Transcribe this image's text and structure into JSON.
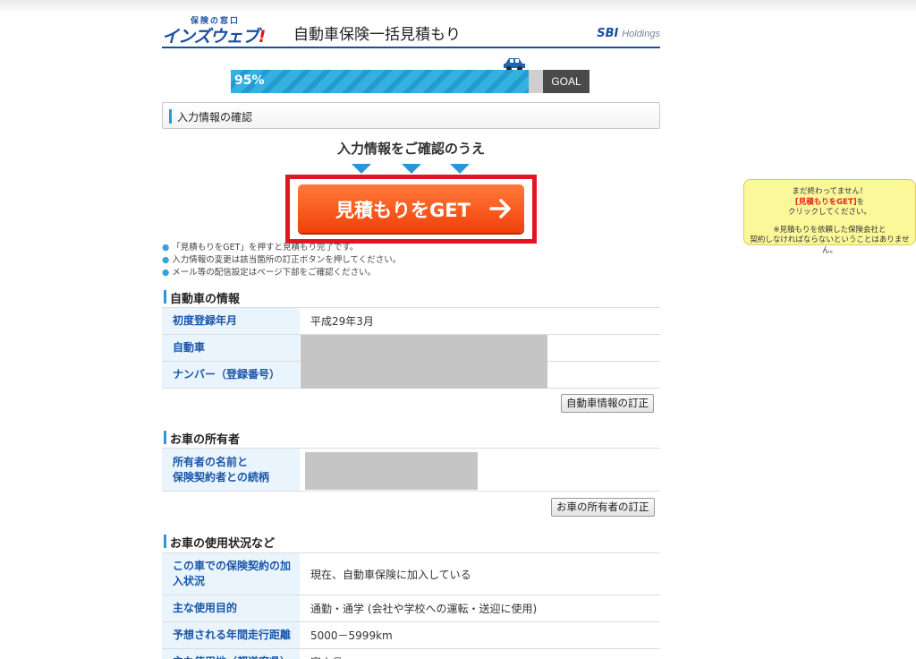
{
  "header": {
    "logo_small": "保険の窓口",
    "logo_main": "インズウェブ",
    "logo_bang": "!",
    "title": "自動車保険一括見積もり",
    "sbi_mark": "SBI",
    "sbi_holdings": "Holdings"
  },
  "progress": {
    "value_percent": 95,
    "label": "95%",
    "goal_label": "GOAL"
  },
  "confirm_section": {
    "title": "入力情報の確認",
    "prompt": "入力情報をご確認のうえ",
    "cta_label": "見積もりをGET",
    "notes": [
      "「見積もりをGET」を押すと見積もり完了です。",
      "入力情報の変更は該当箇所の訂正ボタンを押してください。",
      "メール等の配信設定はページ下部をご確認ください。"
    ]
  },
  "car_info": {
    "title": "自動車の情報",
    "rows": [
      {
        "label": "初度登録年月",
        "value": "平成29年3月"
      },
      {
        "label": "自動車",
        "value": ""
      },
      {
        "label": "ナンバー（登録番号）",
        "value": ""
      }
    ],
    "edit_button": "自動車情報の訂正"
  },
  "owner_info": {
    "title": "お車の所有者",
    "row_label_1": "所有者の名前と",
    "row_label_2": "保険契約者との続柄",
    "edit_button": "お車の所有者の訂正"
  },
  "usage_info": {
    "title": "お車の使用状況など",
    "rows": [
      {
        "label_1": "この車での保険契約の加",
        "label_2": "入状況",
        "value": "現在、自動車保険に加入している"
      },
      {
        "label_1": "主な使用目的",
        "value": "通勤・通学 (会社や学校への運転・送迎に使用)"
      },
      {
        "label_1": "予想される年間走行距離",
        "value": "5000－5999km"
      },
      {
        "label_1": "主な使用地（都道府県）",
        "value": "富山県"
      }
    ]
  },
  "tooltip": {
    "line1": "まだ終わってません！",
    "line2_red": "[見積もりをGET]",
    "line2_rest": "を",
    "line3": "クリックしてください。",
    "line4": "※見積もりを依頼した保険会社と",
    "line5": "契約しなければならないということはありません。"
  },
  "colors": {
    "accent": "#1a4ea2",
    "cta": "#f2400a",
    "highlight_frame": "#e11624",
    "progress": "#35b1e0"
  }
}
